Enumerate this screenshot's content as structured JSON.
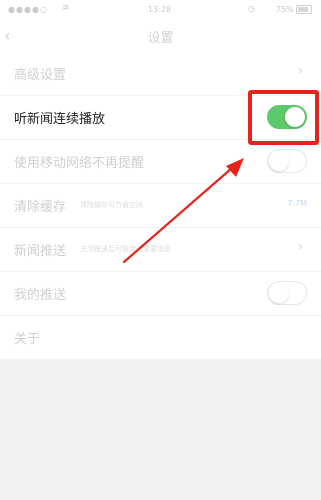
{
  "status_bar": {
    "signal": "●●●●○",
    "wifi": "≋",
    "time": "13:28",
    "alarm": "◷",
    "battery_pct": "75%"
  },
  "nav": {
    "back_icon": "chevron-left-icon",
    "title": "设置"
  },
  "rows": [
    {
      "label": "高级设置",
      "control": "chevron"
    },
    {
      "label": "听新闻连续播放",
      "control": "toggle",
      "toggle_on": true
    },
    {
      "label": "使用移动网络不再提醒",
      "control": "toggle",
      "toggle_on": false
    },
    {
      "label": "清除缓存",
      "description": "清除缓存可节省空间",
      "value": "7.7M"
    },
    {
      "label": "新闻推送",
      "description": "关闭推送后可能错过重要消息",
      "control": "chevron"
    },
    {
      "label": "我的推送",
      "control": "toggle",
      "toggle_on": false
    },
    {
      "label": "关于"
    }
  ],
  "colors": {
    "toggle_on": "#5cc96a",
    "highlight": "#e8231d",
    "arrow": "#e8231d"
  }
}
